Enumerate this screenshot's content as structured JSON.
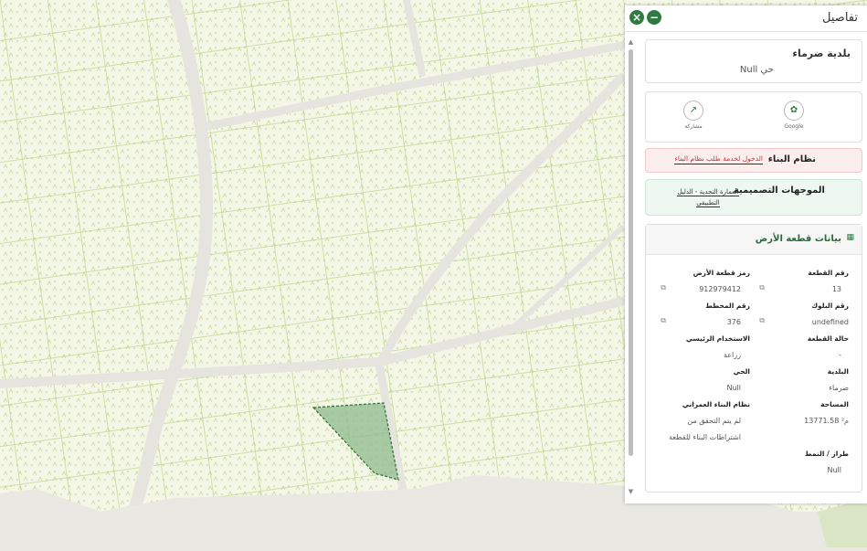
{
  "panel": {
    "title": "تفاصيل",
    "close_label": "×",
    "minimize_label": "−",
    "municipality_card": {
      "title": "بلدية ضرماء",
      "subtitle": "حي Null"
    },
    "actions": [
      {
        "label": "Google",
        "icon": "map-pin-icon"
      },
      {
        "label": "مشاركة",
        "icon": "share-icon"
      }
    ],
    "building_system": {
      "label": "نظام البناء",
      "link": "الدخول لخدمة طلب نظام البناء"
    },
    "design_guidelines": {
      "label": "الموجهات التصميمية",
      "link_line1": "العمارة النجدية - الدليل",
      "link_line2": "التطبيقي"
    },
    "parcel": {
      "title": "بيانات قطعة الأرض",
      "fields": {
        "parcel_no": {
          "label": "رقم القطعة",
          "value": "13"
        },
        "land_code": {
          "label": "رمز قطعة الأرض",
          "value": "912979412"
        },
        "block_no": {
          "label": "رقم البلوك",
          "value": "undefined"
        },
        "plan_no": {
          "label": "رقم المخطط",
          "value": "376"
        },
        "parcel_status": {
          "label": "حالة القطعة",
          "value": "-"
        },
        "main_use": {
          "label": "الاستخدام الرئيسي",
          "value": "زراعة"
        },
        "municipality": {
          "label": "البلدية",
          "value": "ضرماء"
        },
        "district": {
          "label": "الحي",
          "value": "Null"
        },
        "area": {
          "label": "المساحة",
          "value": "13771.58 م²"
        },
        "urban_code": {
          "label": "نظام البناء العمراني",
          "value_line1": "لم يتم التحقق من",
          "value_line2": "اشتراطات البناء للقطعة"
        },
        "style": {
          "label": "طراز / النمط",
          "value": "Null"
        }
      }
    }
  },
  "colors": {
    "accent": "#2f7a40",
    "map_bg": "#f3f6e6",
    "road": "#e4e2dc",
    "parcel_line": "#b5cf7f",
    "selected_fill": "#8db98d"
  }
}
